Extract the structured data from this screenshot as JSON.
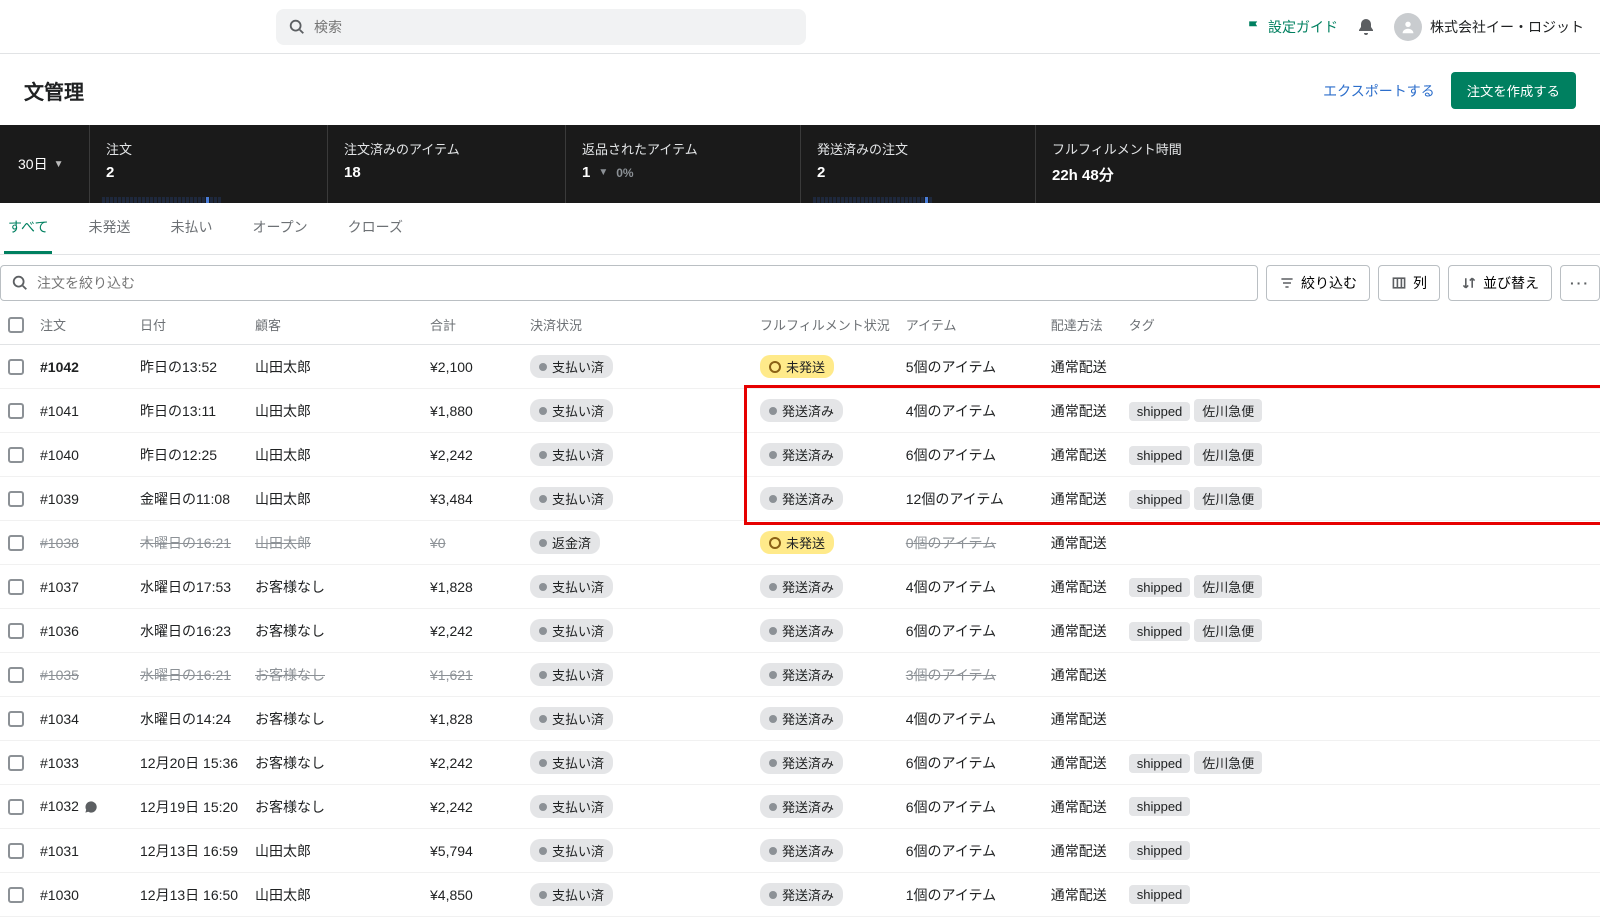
{
  "topbar": {
    "search_placeholder": "検索",
    "setup_guide": "設定ガイド",
    "account_name": "株式会社イー・ロジット"
  },
  "page": {
    "title": "文管理",
    "export": "エクスポートする",
    "create": "注文を作成する"
  },
  "stats": {
    "period": "30日",
    "cells": [
      {
        "label": "注文",
        "value": "2"
      },
      {
        "label": "注文済みのアイテム",
        "value": "18"
      },
      {
        "label": "返品されたアイテム",
        "value": "1",
        "sub": "0%"
      },
      {
        "label": "発送済みの注文",
        "value": "2"
      },
      {
        "label": "フルフィルメント時間",
        "value": "22h 48分"
      }
    ]
  },
  "tabs": [
    "すべて",
    "未発送",
    "未払い",
    "オープン",
    "クローズ"
  ],
  "filter": {
    "placeholder": "注文を絞り込む",
    "narrow": "絞り込む",
    "columns": "列",
    "sort": "並び替え"
  },
  "columns": {
    "order": "注文",
    "date": "日付",
    "customer": "顧客",
    "total": "合計",
    "payment": "決済状況",
    "fulfillment": "フルフィルメント状況",
    "items": "アイテム",
    "delivery": "配達方法",
    "tags": "タグ"
  },
  "delivery_std": "通常配送",
  "pay_paid": "支払い済",
  "pay_refunded": "返金済",
  "ff_unshipped": "未発送",
  "ff_shipped": "発送済み",
  "rows": [
    {
      "id": "#1042",
      "bold": true,
      "date": "昨日の13:52",
      "cust": "山田太郎",
      "total": "¥2,100",
      "pay": "paid",
      "ff": "unshipped",
      "items": "5個のアイテム",
      "tags": []
    },
    {
      "id": "#1041",
      "date": "昨日の13:11",
      "cust": "山田太郎",
      "total": "¥1,880",
      "pay": "paid",
      "ff": "shipped",
      "items": "4個のアイテム",
      "tags": [
        "shipped",
        "佐川急便"
      ]
    },
    {
      "id": "#1040",
      "date": "昨日の12:25",
      "cust": "山田太郎",
      "total": "¥2,242",
      "pay": "paid",
      "ff": "shipped",
      "items": "6個のアイテム",
      "tags": [
        "shipped",
        "佐川急便"
      ]
    },
    {
      "id": "#1039",
      "date": "金曜日の11:08",
      "cust": "山田太郎",
      "total": "¥3,484",
      "pay": "paid",
      "ff": "shipped",
      "items": "12個のアイテム",
      "tags": [
        "shipped",
        "佐川急便"
      ]
    },
    {
      "id": "#1038",
      "date": "木曜日の16:21",
      "cust": "山田太郎",
      "total": "¥0",
      "pay": "refunded",
      "ff": "unshipped",
      "items": "0個のアイテム",
      "struck": true,
      "tags": []
    },
    {
      "id": "#1037",
      "date": "水曜日の17:53",
      "cust": "お客様なし",
      "total": "¥1,828",
      "pay": "paid",
      "ff": "shipped",
      "items": "4個のアイテム",
      "tags": [
        "shipped",
        "佐川急便"
      ]
    },
    {
      "id": "#1036",
      "date": "水曜日の16:23",
      "cust": "お客様なし",
      "total": "¥2,242",
      "pay": "paid",
      "ff": "shipped",
      "items": "6個のアイテム",
      "tags": [
        "shipped",
        "佐川急便"
      ]
    },
    {
      "id": "#1035",
      "date": "水曜日の16:21",
      "cust": "お客様なし",
      "total": "¥1,621",
      "pay": "paid",
      "ff": "shipped",
      "items": "3個のアイテム",
      "struck": true,
      "tags": []
    },
    {
      "id": "#1034",
      "date": "水曜日の14:24",
      "cust": "お客様なし",
      "total": "¥1,828",
      "pay": "paid",
      "ff": "shipped",
      "items": "4個のアイテム",
      "tags": []
    },
    {
      "id": "#1033",
      "date": "12月20日 15:36",
      "cust": "お客様なし",
      "total": "¥2,242",
      "pay": "paid",
      "ff": "shipped",
      "items": "6個のアイテム",
      "tags": [
        "shipped",
        "佐川急便"
      ]
    },
    {
      "id": "#1032",
      "note": true,
      "date": "12月19日 15:20",
      "cust": "お客様なし",
      "total": "¥2,242",
      "pay": "paid",
      "ff": "shipped",
      "items": "6個のアイテム",
      "tags": [
        "shipped"
      ]
    },
    {
      "id": "#1031",
      "date": "12月13日 16:59",
      "cust": "山田太郎",
      "total": "¥5,794",
      "pay": "paid",
      "ff": "shipped",
      "items": "6個のアイテム",
      "tags": [
        "shipped"
      ]
    },
    {
      "id": "#1030",
      "date": "12月13日 16:50",
      "cust": "山田太郎",
      "total": "¥4,850",
      "pay": "paid",
      "ff": "shipped",
      "items": "1個のアイテム",
      "tags": [
        "shipped"
      ]
    }
  ],
  "highlight": {
    "top_row": 1,
    "bottom_row": 3
  }
}
